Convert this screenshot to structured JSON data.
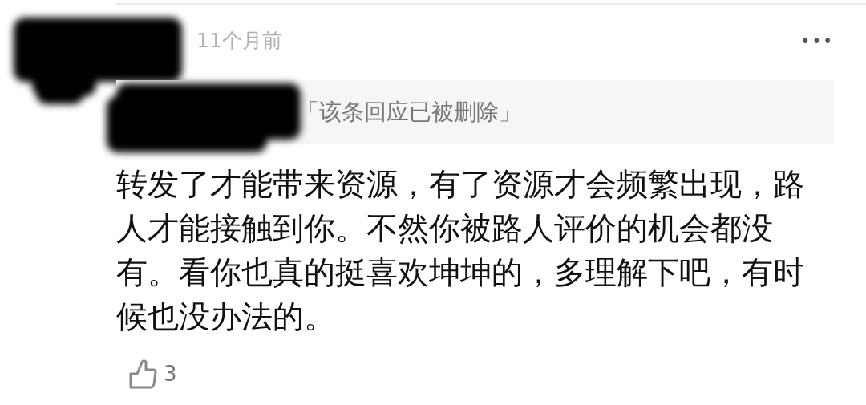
{
  "comment": {
    "time": "11个月前",
    "more": "•••",
    "quote": "「该条回应已被删除」",
    "body": "转发了才能带来资源，有了资源才会频繁出现，路人才能接触到你。不然你被路人评价的机会都没有。看你也真的挺喜欢坤坤的，多理解下吧，有时候也没办法的。",
    "likes": "3"
  }
}
